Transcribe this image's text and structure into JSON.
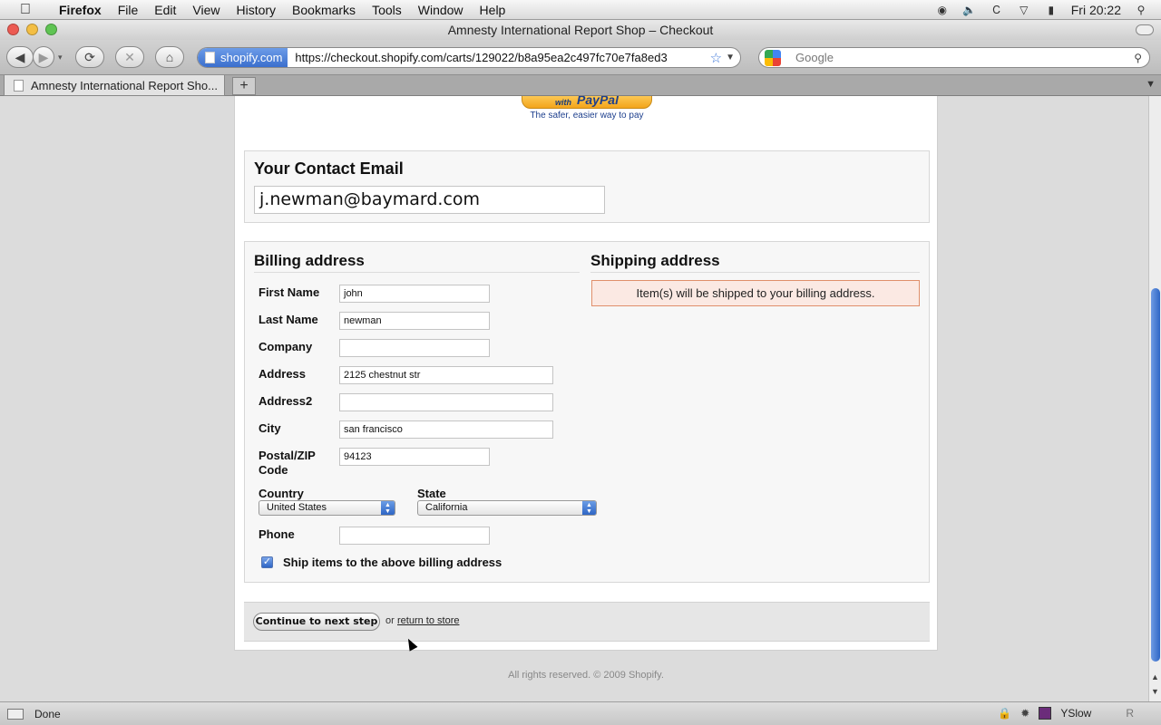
{
  "menubar": {
    "app": "Firefox",
    "items": [
      "File",
      "Edit",
      "View",
      "History",
      "Bookmarks",
      "Tools",
      "Window",
      "Help"
    ],
    "clock": "Fri 20:22"
  },
  "window": {
    "title": "Amnesty International Report Shop – Checkout"
  },
  "toolbar": {
    "site_identity": "shopify.com",
    "url": "https://checkout.shopify.com/carts/129022/b8a95ea2c497fc70e7fa8ed3",
    "search_placeholder": "Google"
  },
  "tabs": [
    {
      "label": "Amnesty International Report Sho..."
    }
  ],
  "page": {
    "paypal": {
      "with": "with",
      "logo": "PayPal",
      "tagline": "The safer, easier way to pay"
    },
    "contact": {
      "heading": "Your Contact Email",
      "email": "j.newman@baymard.com"
    },
    "billing": {
      "heading": "Billing address",
      "first_name_label": "First Name",
      "first_name": "john",
      "last_name_label": "Last Name",
      "last_name": "newman",
      "company_label": "Company",
      "company": "",
      "address_label": "Address",
      "address": "2125 chestnut str",
      "address2_label": "Address2",
      "address2": "",
      "city_label": "City",
      "city": "san francisco",
      "zip_label_1": "Postal/ZIP",
      "zip_label_2": "Code",
      "zip": "94123",
      "country_label": "Country",
      "country": "United States",
      "state_label": "State",
      "state": "California",
      "phone_label": "Phone",
      "phone": "",
      "ship_same_label": "Ship items to the above billing address",
      "ship_same_checked": true
    },
    "shipping": {
      "heading": "Shipping address",
      "note": "Item(s) will be shipped to your billing address."
    },
    "actions": {
      "continue": "Continue to next step",
      "or": "or",
      "return": "return to store"
    },
    "copyright": "All rights reserved. © 2009 Shopify."
  },
  "statusbar": {
    "status": "Done",
    "yslow": "YSlow",
    "r": "R"
  },
  "colors": {
    "accent": "#2f66c5",
    "notice_bg": "#fbe9e3",
    "notice_border": "#e08f6b"
  }
}
